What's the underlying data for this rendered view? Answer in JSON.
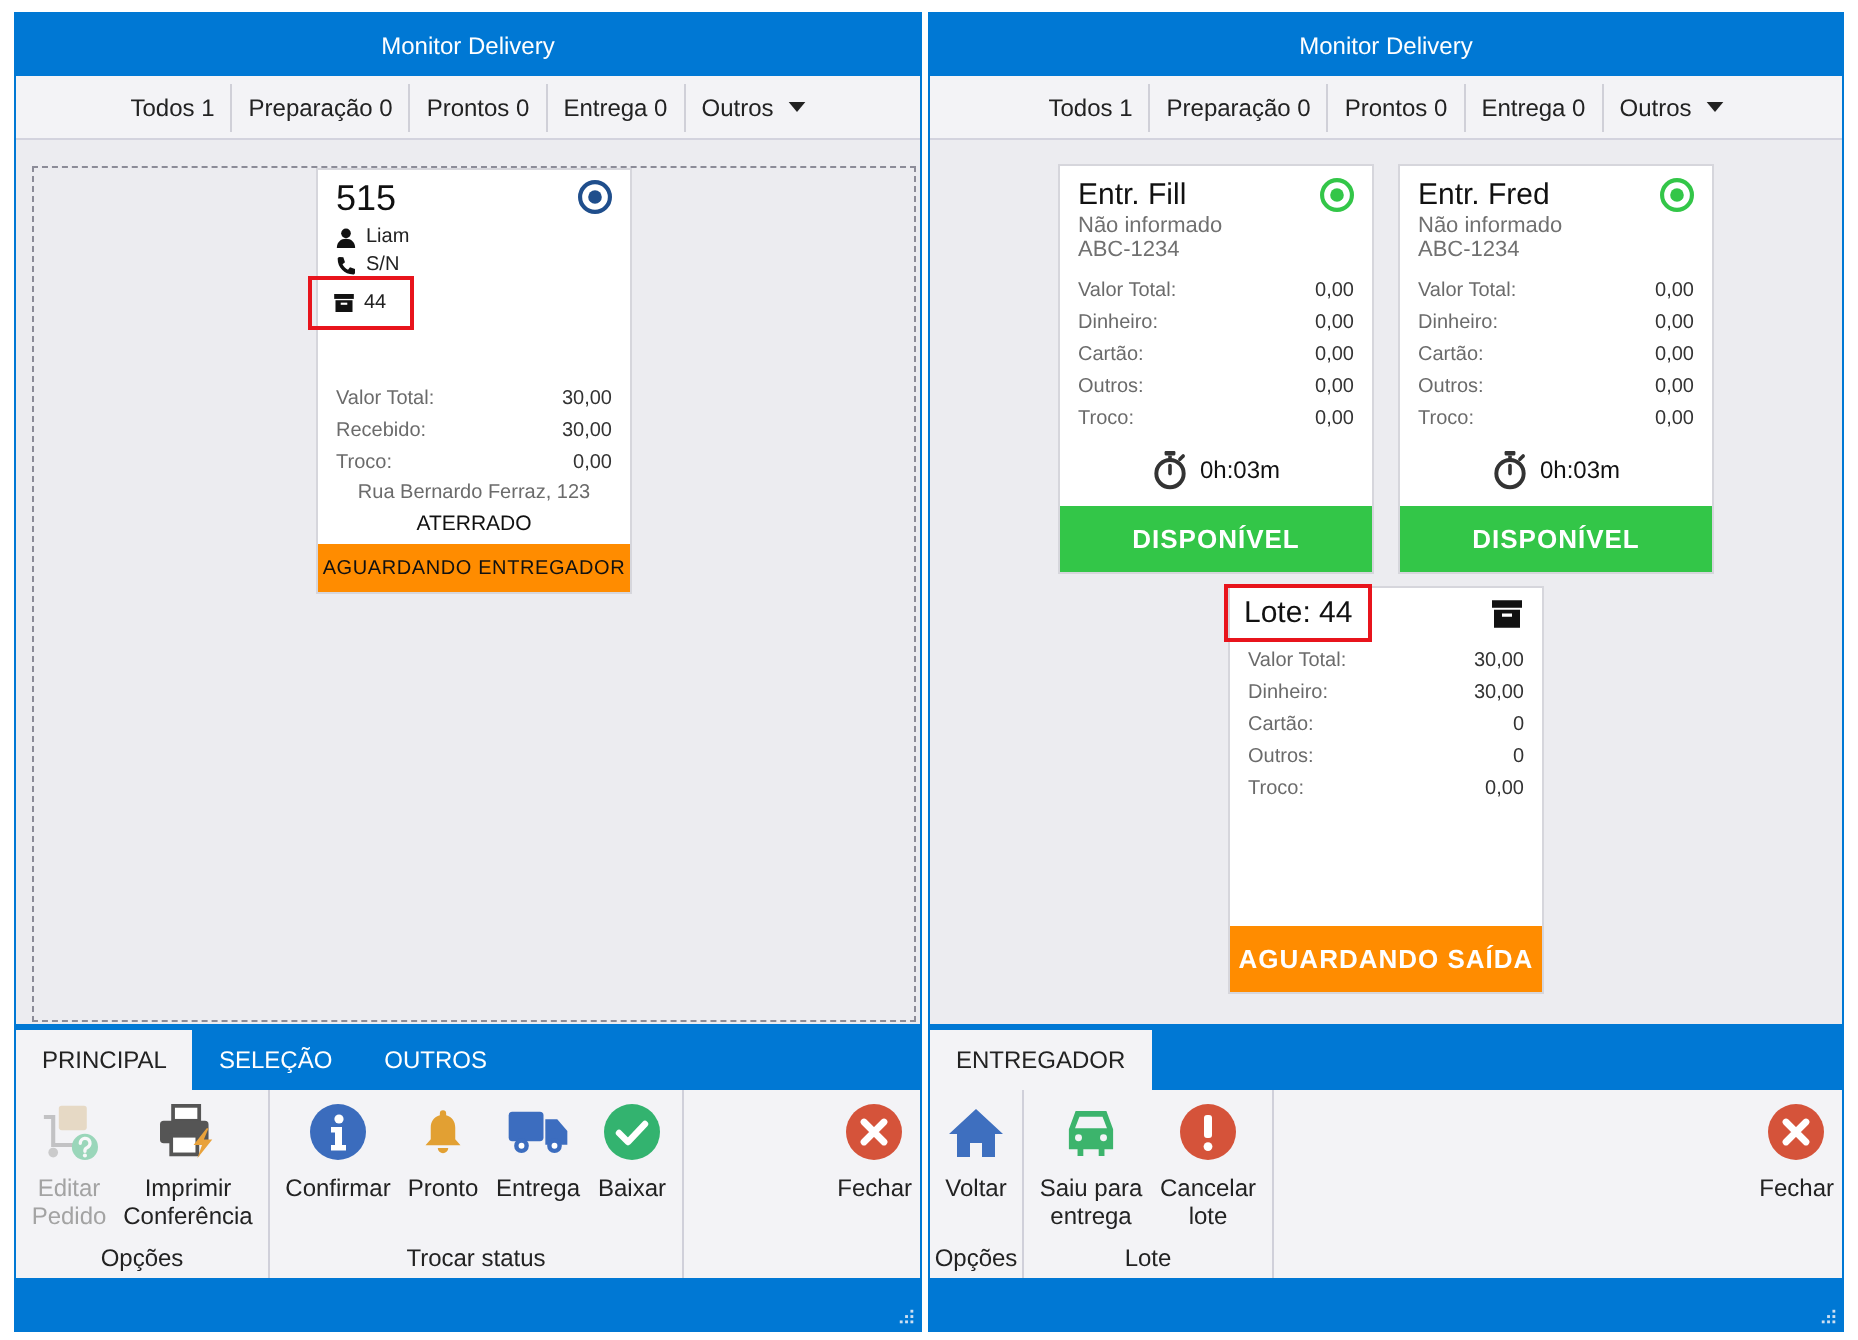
{
  "windows": [
    {
      "title": "Monitor Delivery",
      "filters": [
        {
          "label": "Todos 1",
          "kind": "count"
        },
        {
          "label": "Preparação 0",
          "kind": "count"
        },
        {
          "label": "Prontos 0",
          "kind": "count"
        },
        {
          "label": "Entrega 0",
          "kind": "count"
        },
        {
          "label": "Outros",
          "kind": "dropdown"
        }
      ],
      "board": {
        "selection_frame": true,
        "cards": [
          {
            "kind": "order",
            "title": "515",
            "indicator": {
              "color": "#1f4e8c"
            },
            "details": [
              {
                "kind": "customer",
                "text": "Liam",
                "highlighted": false
              },
              {
                "kind": "phone",
                "text": "S/N",
                "highlighted": false
              },
              {
                "kind": "batch",
                "text": "44",
                "highlighted": true
              }
            ],
            "amounts": [
              {
                "label": "Valor Total:",
                "value": "30,00"
              },
              {
                "label": "Recebido:",
                "value": "30,00"
              },
              {
                "label": "Troco:",
                "value": "0,00"
              }
            ],
            "address": "Rua Bernardo Ferraz, 123",
            "neighborhood": "ATERRADO",
            "status": {
              "label": "AGUARDANDO ENTREGADOR",
              "color": "#ff8c00"
            }
          }
        ]
      },
      "ribbon": {
        "tabs": [
          {
            "label": "PRINCIPAL",
            "selected": true
          },
          {
            "label": "SELEÇÃO",
            "selected": false
          },
          {
            "label": "OUTROS",
            "selected": false
          }
        ],
        "groups": [
          {
            "label": "Opções",
            "buttons": [
              {
                "kind": "edit",
                "label": "Editar Pedido",
                "disabled": true
              },
              {
                "kind": "print",
                "label": "Imprimir Conferência",
                "disabled": false
              }
            ]
          },
          {
            "label": "Trocar status",
            "buttons": [
              {
                "kind": "confirm",
                "label": "Confirmar",
                "disabled": false
              },
              {
                "kind": "ready",
                "label": "Pronto",
                "disabled": false
              },
              {
                "kind": "delivery",
                "label": "Entrega",
                "disabled": false
              },
              {
                "kind": "finish",
                "label": "Baixar",
                "disabled": false
              }
            ]
          }
        ],
        "close_button": {
          "label": "Fechar"
        }
      }
    },
    {
      "title": "Monitor Delivery",
      "filters": [
        {
          "label": "Todos 1",
          "kind": "count"
        },
        {
          "label": "Preparação 0",
          "kind": "count"
        },
        {
          "label": "Prontos 0",
          "kind": "count"
        },
        {
          "label": "Entrega 0",
          "kind": "count"
        },
        {
          "label": "Outros",
          "kind": "dropdown"
        }
      ],
      "board": {
        "selection_frame": false,
        "cards": [
          {
            "kind": "courier",
            "title": "Entr. Fill",
            "lines": [
              "Não informado",
              "ABC-1234"
            ],
            "indicator": {
              "color": "#33c648"
            },
            "amounts": [
              {
                "label": "Valor Total:",
                "value": "0,00"
              },
              {
                "label": "Dinheiro:",
                "value": "0,00"
              },
              {
                "label": "Cartão:",
                "value": "0,00"
              },
              {
                "label": "Outros:",
                "value": "0,00"
              },
              {
                "label": "Troco:",
                "value": "0,00"
              }
            ],
            "timer": "0h:03m",
            "status": {
              "label": "DISPONÍVEL",
              "color": "#33c648"
            }
          },
          {
            "kind": "courier",
            "title": "Entr. Fred",
            "lines": [
              "Não informado",
              "ABC-1234"
            ],
            "indicator": {
              "color": "#33c648"
            },
            "amounts": [
              {
                "label": "Valor Total:",
                "value": "0,00"
              },
              {
                "label": "Dinheiro:",
                "value": "0,00"
              },
              {
                "label": "Cartão:",
                "value": "0,00"
              },
              {
                "label": "Outros:",
                "value": "0,00"
              },
              {
                "label": "Troco:",
                "value": "0,00"
              }
            ],
            "timer": "0h:03m",
            "status": {
              "label": "DISPONÍVEL",
              "color": "#33c648"
            }
          },
          {
            "kind": "batch",
            "title": "Lote: 44",
            "highlighted": true,
            "amounts": [
              {
                "label": "Valor Total:",
                "value": "30,00"
              },
              {
                "label": "Dinheiro:",
                "value": "30,00"
              },
              {
                "label": "Cartão:",
                "value": "0"
              },
              {
                "label": "Outros:",
                "value": "0"
              },
              {
                "label": "Troco:",
                "value": "0,00"
              }
            ],
            "status": {
              "label": "AGUARDANDO SAÍDA",
              "color": "#ff8c00"
            }
          }
        ]
      },
      "ribbon": {
        "tabs": [
          {
            "label": "ENTREGADOR",
            "selected": true
          }
        ],
        "groups": [
          {
            "label": "Opções",
            "buttons": [
              {
                "kind": "back",
                "label": "Voltar",
                "disabled": false
              }
            ]
          },
          {
            "label": "Lote",
            "buttons": [
              {
                "kind": "depart",
                "label": "Saiu para entrega",
                "disabled": false
              },
              {
                "kind": "cancel",
                "label": "Cancelar lote",
                "disabled": false
              }
            ]
          }
        ],
        "close_button": {
          "label": "Fechar"
        }
      }
    }
  ]
}
